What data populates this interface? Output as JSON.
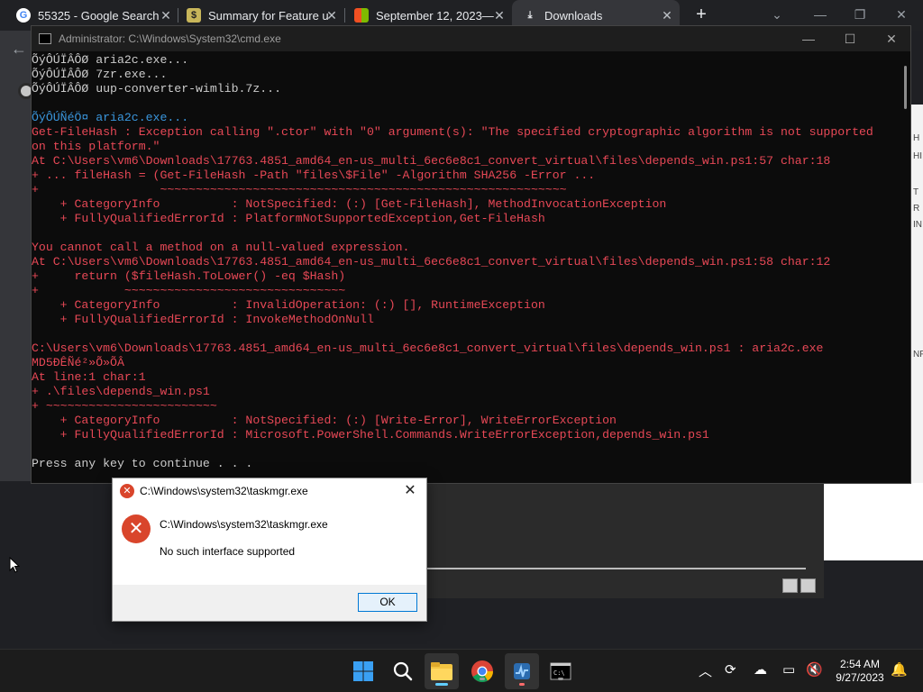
{
  "browser": {
    "tabs": [
      {
        "label": "55325 - Google Search"
      },
      {
        "label": "Summary for Feature u"
      },
      {
        "label": "September 12, 2023—"
      },
      {
        "label": "Downloads"
      }
    ],
    "right_strip_letters": [
      "H",
      "HI",
      "T",
      "R",
      "IN",
      "NF"
    ]
  },
  "console": {
    "title": "Administrator: C:\\Windows\\System32\\cmd.exe",
    "lines": [
      {
        "cls": "norm",
        "text": "ÕýÔÚÏÂÔØ aria2c.exe..."
      },
      {
        "cls": "norm",
        "text": "ÕýÔÚÏÂÔØ 7zr.exe..."
      },
      {
        "cls": "norm",
        "text": "ÕýÔÚÏÂÔØ uup-converter-wimlib.7z..."
      },
      {
        "cls": "norm",
        "text": ""
      },
      {
        "cls": "info",
        "text": "ÕýÔÚÑéÖ¤ aria2c.exe..."
      },
      {
        "cls": "err",
        "text": "Get-FileHash : Exception calling \".ctor\" with \"0\" argument(s): \"The specified cryptographic algorithm is not supported"
      },
      {
        "cls": "err",
        "text": "on this platform.\""
      },
      {
        "cls": "err",
        "text": "At C:\\Users\\vm6\\Downloads\\17763.4851_amd64_en-us_multi_6ec6e8c1_convert_virtual\\files\\depends_win.ps1:57 char:18"
      },
      {
        "cls": "err",
        "text": "+ ... fileHash = (Get-FileHash -Path \"files\\$File\" -Algorithm SHA256 -Error ..."
      },
      {
        "cls": "err",
        "text": "+                 ~~~~~~~~~~~~~~~~~~~~~~~~~~~~~~~~~~~~~~~~~~~~~~~~~~~~~~~~~"
      },
      {
        "cls": "err",
        "text": "    + CategoryInfo          : NotSpecified: (:) [Get-FileHash], MethodInvocationException"
      },
      {
        "cls": "err",
        "text": "    + FullyQualifiedErrorId : PlatformNotSupportedException,Get-FileHash"
      },
      {
        "cls": "err",
        "text": ""
      },
      {
        "cls": "err",
        "text": "You cannot call a method on a null-valued expression."
      },
      {
        "cls": "err",
        "text": "At C:\\Users\\vm6\\Downloads\\17763.4851_amd64_en-us_multi_6ec6e8c1_convert_virtual\\files\\depends_win.ps1:58 char:12"
      },
      {
        "cls": "err",
        "text": "+     return ($fileHash.ToLower() -eq $Hash)"
      },
      {
        "cls": "err",
        "text": "+            ~~~~~~~~~~~~~~~~~~~~~~~~~~~~~~~"
      },
      {
        "cls": "err",
        "text": "    + CategoryInfo          : InvalidOperation: (:) [], RuntimeException"
      },
      {
        "cls": "err",
        "text": "    + FullyQualifiedErrorId : InvokeMethodOnNull"
      },
      {
        "cls": "err",
        "text": ""
      },
      {
        "cls": "err",
        "text": "C:\\Users\\vm6\\Downloads\\17763.4851_amd64_en-us_multi_6ec6e8c1_convert_virtual\\files\\depends_win.ps1 : aria2c.exe"
      },
      {
        "cls": "err",
        "text": "MD5ÐÊÑé²»Õ»ÕÂ"
      },
      {
        "cls": "err",
        "text": "At line:1 char:1"
      },
      {
        "cls": "err",
        "text": "+ .\\files\\depends_win.ps1"
      },
      {
        "cls": "err",
        "text": "+ ~~~~~~~~~~~~~~~~~~~~~~~~"
      },
      {
        "cls": "err",
        "text": "    + CategoryInfo          : NotSpecified: (:) [Write-Error], WriteErrorException"
      },
      {
        "cls": "err",
        "text": "    + FullyQualifiedErrorId : Microsoft.PowerShell.Commands.WriteErrorException,depends_win.ps1"
      },
      {
        "cls": "err",
        "text": ""
      },
      {
        "cls": "norm",
        "text": "Press any key to continue . . ."
      }
    ]
  },
  "dialog": {
    "title": "C:\\Windows\\system32\\taskmgr.exe",
    "path_text": "C:\\Windows\\system32\\taskmgr.exe",
    "message": "No such interface supported",
    "ok_label": "OK"
  },
  "taskbar": {
    "time": "2:54 AM",
    "date": "9/27/2023"
  },
  "colors": {
    "console_bg": "#0c0c0c",
    "console_error": "#e74856",
    "console_info": "#3a96dd",
    "error_icon": "#d9452b",
    "accent": "#0078d4"
  }
}
